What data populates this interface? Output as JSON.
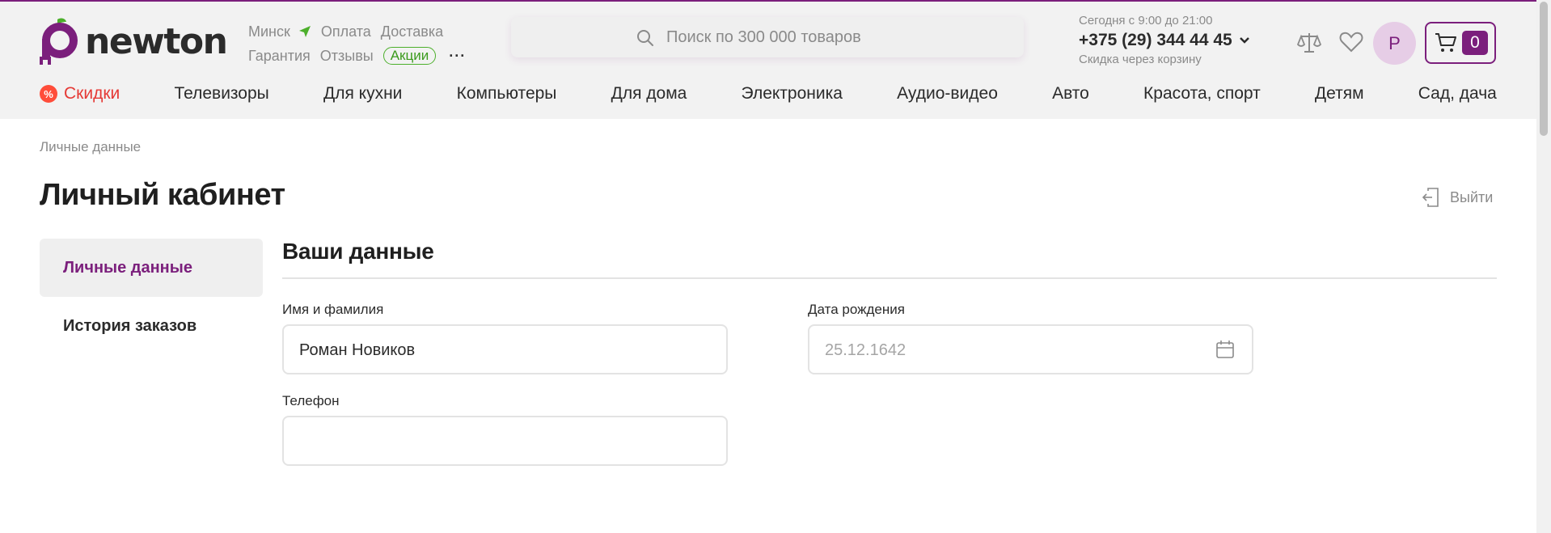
{
  "brand": {
    "name": "newton",
    "accent": "#7b1f7c",
    "sale_color": "#e53935",
    "promo_color": "#3b9a1d"
  },
  "header": {
    "top_links_row1": [
      "Минск",
      "Оплата",
      "Доставка"
    ],
    "top_links_row2": [
      "Гарантия",
      "Отзывы"
    ],
    "promo_label": "Акции",
    "more_label": "···",
    "search_placeholder": "Поиск по 300 000 товаров",
    "hours": "Сегодня с 9:00 до 21:00",
    "phone": "+375 (29) 344 44 45",
    "discount_note": "Скидка через корзину",
    "avatar_letter": "Р",
    "cart_count": "0",
    "icons": [
      "search-icon",
      "location-arrow-icon",
      "compare-scales-icon",
      "heart-icon",
      "cart-icon",
      "chevron-down-icon"
    ]
  },
  "nav": {
    "sale_badge": "%",
    "items": [
      "Скидки",
      "Телевизоры",
      "Для кухни",
      "Компьютеры",
      "Для дома",
      "Электроника",
      "Аудио-видео",
      "Авто",
      "Красота, спорт",
      "Детям",
      "Сад, дача"
    ]
  },
  "page": {
    "breadcrumb": "Личные данные",
    "title": "Личный кабинет",
    "logout_label": "Выйти"
  },
  "sidebar": {
    "items": [
      {
        "label": "Личные данные",
        "active": true
      },
      {
        "label": "История заказов",
        "active": false
      }
    ]
  },
  "profile": {
    "section_title": "Ваши данные",
    "name_label": "Имя и фамилия",
    "name_value": "Роман Новиков",
    "dob_label": "Дата рождения",
    "dob_placeholder": "25.12.1642",
    "phone_label": "Телефон",
    "phone_value": ""
  }
}
